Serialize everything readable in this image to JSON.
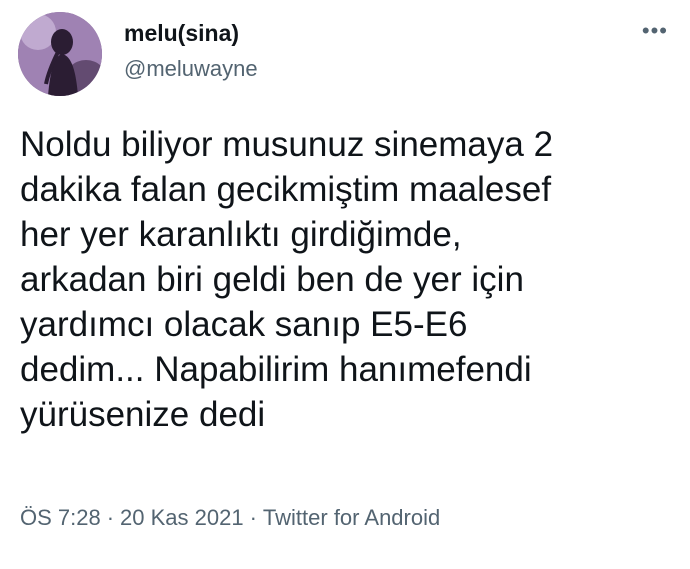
{
  "user": {
    "name": "melu(sina)",
    "handle": "@meluwayne"
  },
  "more_icon": "more-horizontal-icon",
  "tweet": {
    "lines": [
      "Noldu biliyor musunuz sinemaya 2",
      "dakika falan gecikmiştim maalesef",
      "her yer karanlıktı girdiğimde,",
      "arkadan biri geldi ben de yer için",
      "yardımcı olacak sanıp E5-E6",
      "dedim... Napabilirim hanımefendi",
      "yürüsenize dedi"
    ]
  },
  "meta": {
    "time": "ÖS 7:28",
    "date": "20 Kas 2021",
    "source": "Twitter for Android",
    "separator": "·"
  },
  "colors": {
    "text": "#0f1419",
    "secondary": "#536471"
  }
}
